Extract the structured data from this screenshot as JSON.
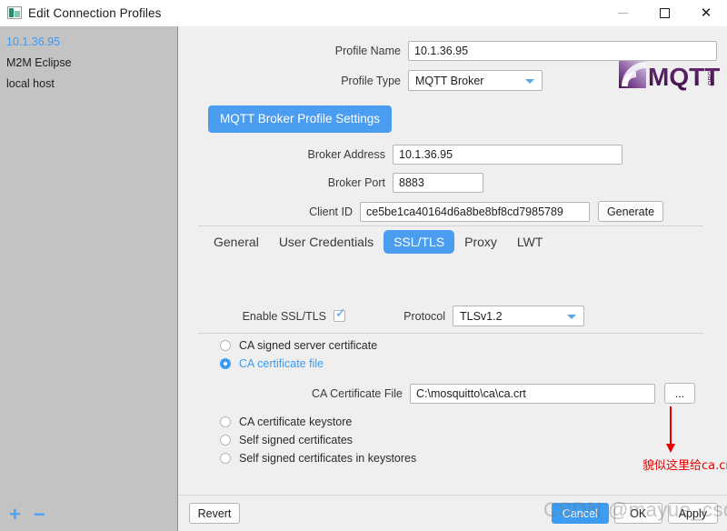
{
  "window": {
    "title": "Edit Connection Profiles",
    "icon": "app-icon",
    "controls": {
      "minimize": "minimize-icon",
      "maximize": "maximize-icon",
      "close": "close-icon"
    }
  },
  "sidebar": {
    "items": [
      {
        "label": "10.1.36.95",
        "selected": true
      },
      {
        "label": "M2M Eclipse",
        "selected": false
      },
      {
        "label": "local host",
        "selected": false
      }
    ],
    "footer": {
      "add": "+",
      "remove": "−"
    }
  },
  "form": {
    "profile_name": {
      "label": "Profile Name",
      "value": "10.1.36.95",
      "placeholder": "Profile Name"
    },
    "profile_type": {
      "label": "Profile Type",
      "value": "MQTT Broker",
      "options": [
        "MQTT Broker"
      ]
    },
    "section_button": "MQTT Broker Profile Settings",
    "logo_text": "MQTT",
    "logo_suffix": ".ORG",
    "broker_address": {
      "label": "Broker Address",
      "value": "10.1.36.95",
      "placeholder": "Broker Address"
    },
    "broker_port": {
      "label": "Broker Port",
      "value": "8883",
      "placeholder": "Broker Port"
    },
    "client_id": {
      "label": "Client ID",
      "value": "ce5be1ca40164d6a8be8bf8cd7985789",
      "placeholder": "Client ID",
      "generate_label": "Generate"
    }
  },
  "tabs": [
    {
      "label": "General",
      "active": false
    },
    {
      "label": "User Credentials",
      "active": false
    },
    {
      "label": "SSL/TLS",
      "active": true
    },
    {
      "label": "Proxy",
      "active": false
    },
    {
      "label": "LWT",
      "active": false
    }
  ],
  "ssl": {
    "enable_label": "Enable SSL/TLS",
    "enable_checked": true,
    "protocol_label": "Protocol",
    "protocol_value": "TLSv1.2",
    "protocol_options": [
      "TLSv1.2"
    ],
    "options": [
      {
        "label": "CA signed server certificate",
        "selected": false
      },
      {
        "label": "CA certificate file",
        "selected": true
      },
      {
        "label": "CA certificate keystore",
        "selected": false
      },
      {
        "label": "Self signed certificates",
        "selected": false
      },
      {
        "label": "Self signed certificates in keystores",
        "selected": false
      }
    ],
    "ca_cert_file": {
      "label": "CA Certificate File",
      "value": "C:\\mosquitto\\ca\\ca.crt",
      "placeholder": "CA Certificate File",
      "browse_label": "..."
    }
  },
  "annotation": {
    "text": "貌似这里给ca.crt和server.crt都OK",
    "color": "#e60000"
  },
  "footer": {
    "revert": "Revert",
    "cancel": "Cancel",
    "ok": "OK",
    "apply": "Apply"
  },
  "watermark": "CSDN @mayue_csdn",
  "colors": {
    "accent": "#4a9df0",
    "sidebar_bg": "#c3c3c3",
    "panel_bg": "#efefef",
    "annotation_red": "#e60000"
  }
}
